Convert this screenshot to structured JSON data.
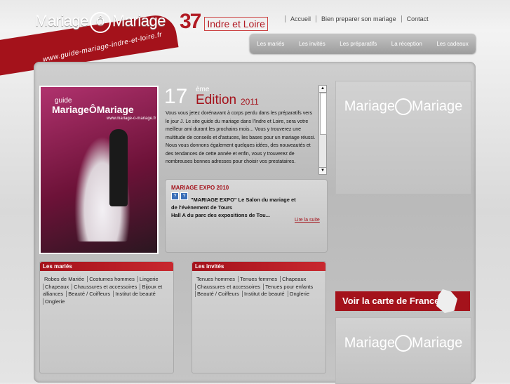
{
  "header": {
    "logo_left": "Mariage",
    "logo_o": "Ô",
    "logo_right": "Mariage",
    "dept_number": "37",
    "dept_name": "Indre et Loire",
    "top_nav": [
      "Accueil",
      "Bien preparer son mariage",
      "Contact"
    ],
    "sub_nav": [
      "Les mariés",
      "Les invités",
      "Les préparatifs",
      "La réception",
      "Les cadeaux"
    ],
    "url_banner": "www.guide-mariage-indre-et-loire.fr"
  },
  "cover": {
    "guide": "guide",
    "title": "MariageÔMariage",
    "url": "www.mariage-o-mariage.fr"
  },
  "edition": {
    "number": "17",
    "suffix": "ème",
    "word": "Edition",
    "year": "2011",
    "text": "Vous vous jetez dorénavant à corps perdu dans les préparatifs vers le jour J. Le site guide du mariage dans l'Indre et Loire, sera votre meilleur ami durant les prochains mois... Vous y trouverez une multitude de conseils et d'astuces, les bases pour un mariage réussi. Nous vous donnons également quelques idées, des nouveautés et des tendances de cette année et enfin, vous y trouverez de nombreuses bonnes adresses pour choisir vos prestataires."
  },
  "news": {
    "title": "MARIAGE EXPO 2010",
    "line1": "\"MARIAGE EXPO\" Le Salon du mariage et",
    "line2": "de l'évènement de Tours",
    "line3": "Hall A du parc des expositions de Tou...",
    "link": "Lire la suite"
  },
  "right": {
    "logo_text_left": "Mariage",
    "logo_text_right": "Mariage",
    "map_button": "Voir la carte de France"
  },
  "maries": {
    "title": "Les mariés",
    "links": [
      "Robes de Mariée",
      "Costumes hommes",
      "Lingerie",
      "Chapeaux",
      "Chaussures et accessoires",
      "Bijoux et alliances",
      "Beauté / Coiffeurs",
      "Institut de beauté",
      "Onglerie"
    ]
  },
  "invites": {
    "title": "Les invités",
    "links": [
      "Tenues hommes",
      "Tenues femmes",
      "Chapeaux",
      "Chaussures et accessoires",
      "Tenues pour enfants",
      "Beauté / Coiffeurs",
      "Institut de beauté",
      "Onglerie"
    ]
  },
  "colors": {
    "brand_red": "#a4121b",
    "panel": "#c4c4c4"
  }
}
